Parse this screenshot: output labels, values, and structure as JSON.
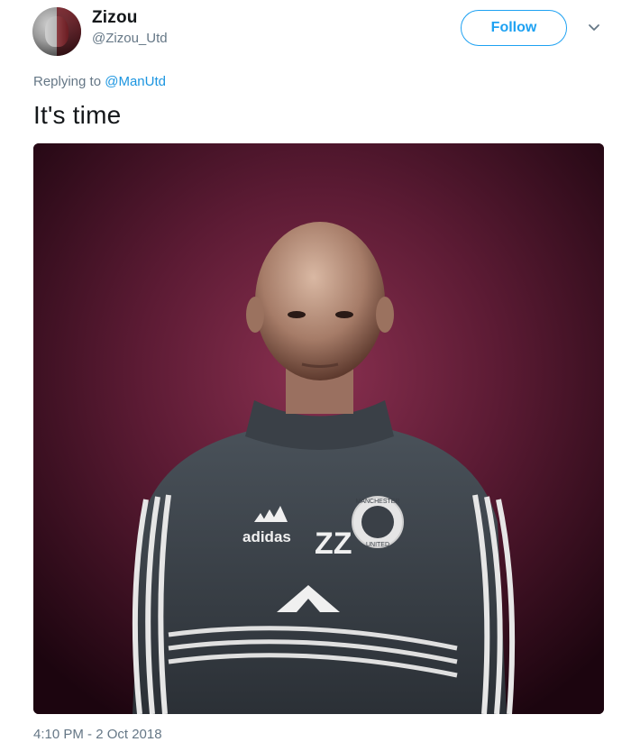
{
  "tweet": {
    "author": {
      "display_name": "Zizou",
      "handle": "@Zizou_Utd",
      "avatar_icon": "profile-avatar"
    },
    "follow_label": "Follow",
    "reply": {
      "prefix": "Replying to ",
      "mention": "@ManUtd"
    },
    "text": "It's time",
    "media": {
      "chest_brand": "adidas",
      "chest_initials": "ZZ",
      "crest_text_top": "MANCHESTER",
      "crest_text_bottom": "UNITED",
      "background_color": "#5a1a32"
    },
    "timestamp": "4:10 PM - 2 Oct 2018"
  },
  "colors": {
    "accent": "#1da1f2",
    "mention": "#1b95e0",
    "secondary_text": "#657786",
    "primary_text": "#14171a"
  }
}
